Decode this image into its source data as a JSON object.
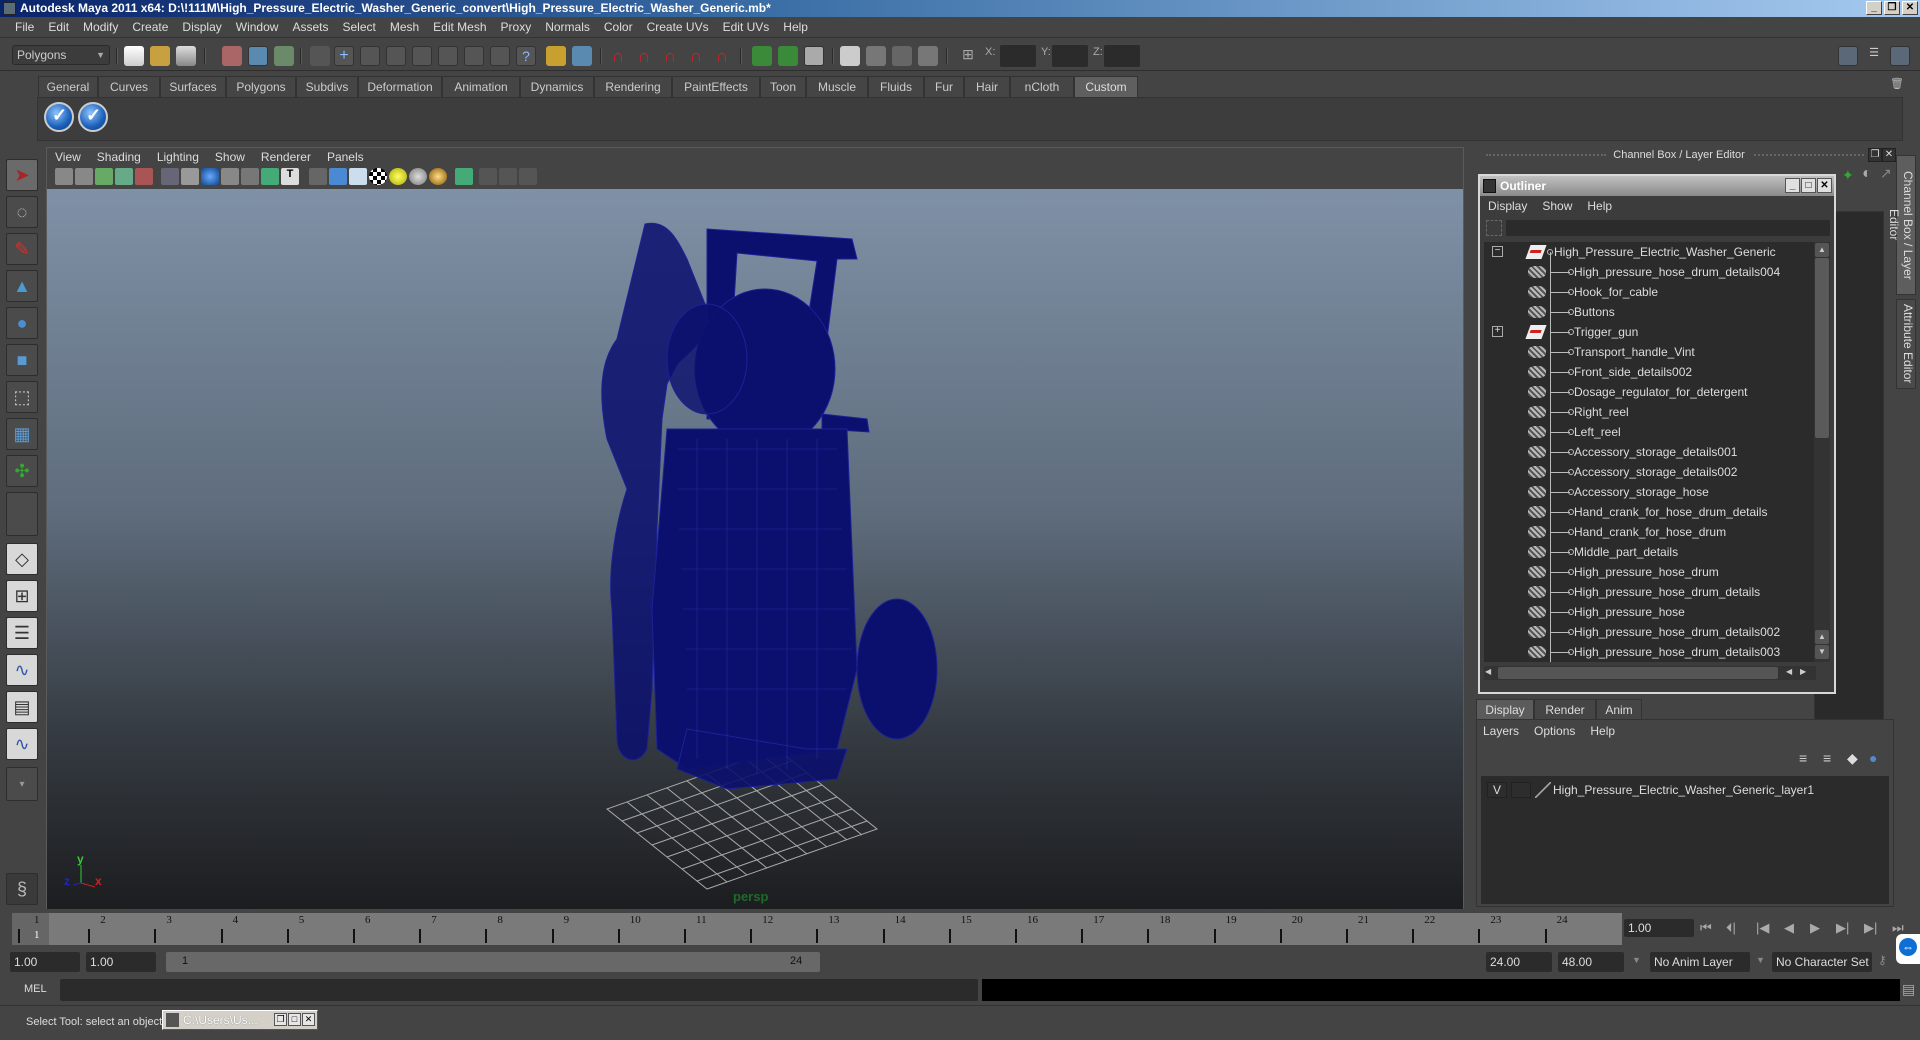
{
  "window": {
    "title": "Autodesk Maya 2011 x64: D:\\!111M\\High_Pressure_Electric_Washer_Generic_convert\\High_Pressure_Electric_Washer_Generic.mb*",
    "controls": [
      "_",
      "❐",
      "✕"
    ]
  },
  "menubar": [
    "File",
    "Edit",
    "Modify",
    "Create",
    "Display",
    "Window",
    "Assets",
    "Select",
    "Mesh",
    "Edit Mesh",
    "Proxy",
    "Normals",
    "Color",
    "Create UVs",
    "Edit UVs",
    "Help"
  ],
  "statusline": {
    "mode": "Polygons",
    "x_label": "X:",
    "y_label": "Y:",
    "z_label": "Z:",
    "x_value": "",
    "y_value": "",
    "z_value": ""
  },
  "shelf": {
    "tabs": [
      "General",
      "Curves",
      "Surfaces",
      "Polygons",
      "Subdivs",
      "Deformation",
      "Animation",
      "Dynamics",
      "Rendering",
      "PaintEffects",
      "Toon",
      "Muscle",
      "Fluids",
      "Fur",
      "Hair",
      "nCloth",
      "Custom"
    ],
    "active_tab": "Custom",
    "items": [
      "checkmark-icon",
      "checkmark-icon"
    ]
  },
  "toolbox": [
    "select-tool",
    "lasso-tool",
    "paint-select-tool",
    "move-tool",
    "rotate-tool",
    "scale-tool",
    "universal-manipulator",
    "soft-modification-tool",
    "show-manipulator",
    "last-used-tool"
  ],
  "viewport": {
    "menu": [
      "View",
      "Shading",
      "Lighting",
      "Show",
      "Renderer",
      "Panels"
    ],
    "camera_label": "persp",
    "wire_color": "#0b0f6e",
    "axis": {
      "x": "x",
      "y": "y",
      "z": "z"
    }
  },
  "channel_box": {
    "header": "Channel Box / Layer Editor"
  },
  "outliner": {
    "title": "Outliner",
    "menu": [
      "Display",
      "Show",
      "Help"
    ],
    "filter_value": "",
    "root": "High_Pressure_Electric_Washer_Generic",
    "items": [
      {
        "name": "High_pressure_hose_drum_details004",
        "type": "mesh"
      },
      {
        "name": "Hook_for_cable",
        "type": "mesh"
      },
      {
        "name": "Buttons",
        "type": "mesh"
      },
      {
        "name": "Trigger_gun",
        "type": "transform",
        "expandable": true
      },
      {
        "name": "Transport_handle_Vint",
        "type": "mesh"
      },
      {
        "name": "Front_side_details002",
        "type": "mesh"
      },
      {
        "name": "Dosage_regulator_for_detergent",
        "type": "mesh"
      },
      {
        "name": "Right_reel",
        "type": "mesh"
      },
      {
        "name": "Left_reel",
        "type": "mesh"
      },
      {
        "name": "Accessory_storage_details001",
        "type": "mesh"
      },
      {
        "name": "Accessory_storage_details002",
        "type": "mesh"
      },
      {
        "name": "Accessory_storage_hose",
        "type": "mesh"
      },
      {
        "name": "Hand_crank_for_hose_drum_details",
        "type": "mesh"
      },
      {
        "name": "Hand_crank_for_hose_drum",
        "type": "mesh"
      },
      {
        "name": "Middle_part_details",
        "type": "mesh"
      },
      {
        "name": "High_pressure_hose_drum",
        "type": "mesh"
      },
      {
        "name": "High_pressure_hose_drum_details",
        "type": "mesh"
      },
      {
        "name": "High_pressure_hose",
        "type": "mesh"
      },
      {
        "name": "High_pressure_hose_drum_details002",
        "type": "mesh"
      },
      {
        "name": "High_pressure_hose_drum_details003",
        "type": "mesh"
      }
    ]
  },
  "layer_editor": {
    "tabs": [
      "Display",
      "Render",
      "Anim"
    ],
    "active_tab": "Display",
    "menu": [
      "Layers",
      "Options",
      "Help"
    ],
    "layers": [
      {
        "visible": "V",
        "name": "High_Pressure_Electric_Washer_Generic_layer1"
      }
    ]
  },
  "side_tabs": [
    "Channel Box / Layer Editor",
    "Attribute Editor"
  ],
  "timeline": {
    "ticks": [
      "1",
      "2",
      "3",
      "4",
      "5",
      "6",
      "7",
      "8",
      "9",
      "10",
      "11",
      "12",
      "13",
      "14",
      "15",
      "16",
      "17",
      "18",
      "19",
      "20",
      "21",
      "22",
      "23",
      "24"
    ],
    "current_marker": "1",
    "current_frame": "1.00"
  },
  "range": {
    "start_time": "1.00",
    "start_playback": "1.00",
    "slider_start": "1",
    "slider_end": "24",
    "end_playback": "24.00",
    "end_time": "48.00",
    "anim_layer": "No Anim Layer",
    "character_set": "No Character Set"
  },
  "command_line": {
    "label": "MEL",
    "value": ""
  },
  "help_line": {
    "text": "Select Tool: select an object",
    "task_button": "C:\\Users\\Us..."
  }
}
